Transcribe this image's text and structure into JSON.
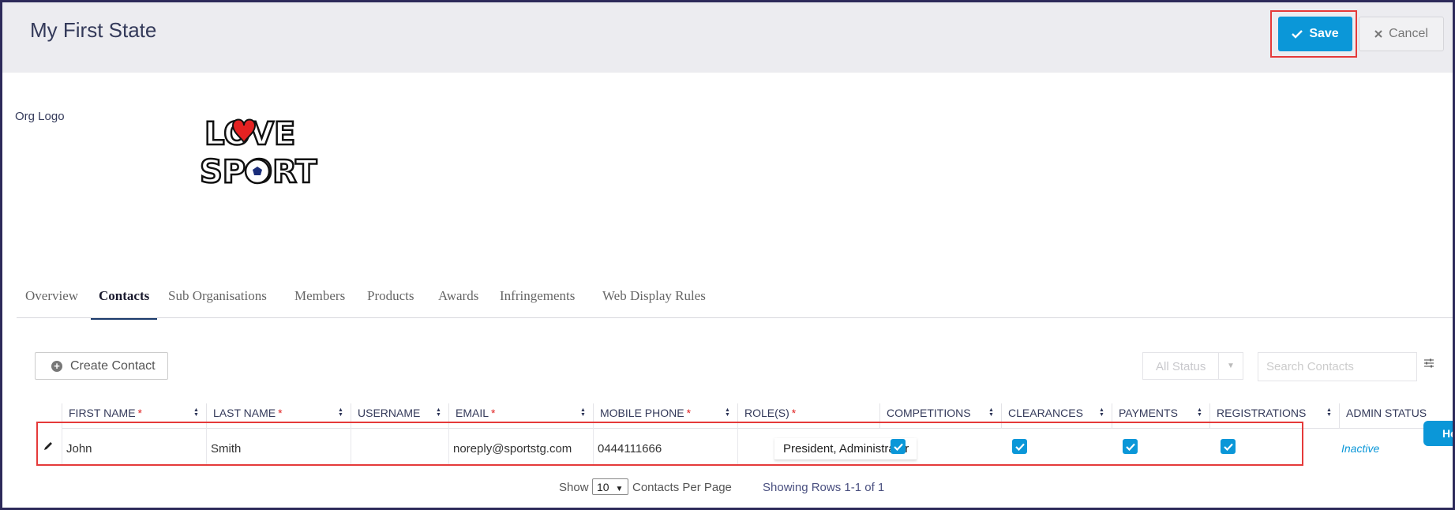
{
  "header": {
    "title": "My First State",
    "save_label": "Save",
    "cancel_label": "Cancel"
  },
  "org": {
    "logo_label": "Org Logo",
    "logo_text_line1": "LOVE",
    "logo_text_line2": "SPORT"
  },
  "tabs": [
    {
      "label": "Overview",
      "active": false
    },
    {
      "label": "Contacts",
      "active": true
    },
    {
      "label": "Sub Organisations",
      "active": false
    },
    {
      "label": "Members",
      "active": false
    },
    {
      "label": "Products",
      "active": false
    },
    {
      "label": "Awards",
      "active": false
    },
    {
      "label": "Infringements",
      "active": false
    },
    {
      "label": "Web Display Rules",
      "active": false
    }
  ],
  "toolbar": {
    "create_label": "Create Contact",
    "status_value": "All Status",
    "search_placeholder": "Search Contacts"
  },
  "table": {
    "columns": [
      {
        "label": "FIRST NAME",
        "required": "*"
      },
      {
        "label": "LAST NAME",
        "required": "*"
      },
      {
        "label": "USERNAME",
        "required": ""
      },
      {
        "label": "EMAIL",
        "required": "*"
      },
      {
        "label": "MOBILE PHONE",
        "required": "*"
      },
      {
        "label": "ROLE(S)",
        "required": "*"
      },
      {
        "label": "COMPETITIONS",
        "required": ""
      },
      {
        "label": "CLEARANCES",
        "required": ""
      },
      {
        "label": "PAYMENTS",
        "required": ""
      },
      {
        "label": "REGISTRATIONS",
        "required": ""
      },
      {
        "label": "ADMIN STATUS",
        "required": ""
      }
    ],
    "rows": [
      {
        "first_name": "John",
        "last_name": "Smith",
        "username": "",
        "email": "noreply@sportstg.com",
        "mobile": "0444111666",
        "roles": "President, Administrator",
        "admin_status": "Inactive"
      }
    ]
  },
  "pager": {
    "show_label": "Show",
    "per_page_value": "10",
    "per_page_suffix": "Contacts Per Page",
    "rows_info": "Showing Rows 1-1 of 1"
  },
  "help": {
    "label": "He"
  },
  "colors": {
    "accent": "#0b97d8",
    "highlight": "#e53a3a",
    "required": "#e02020"
  }
}
